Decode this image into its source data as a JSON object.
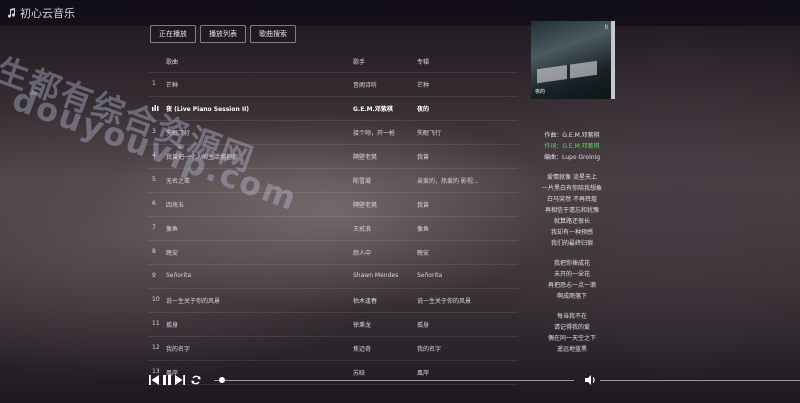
{
  "app": {
    "title": "初心云音乐"
  },
  "tabs": [
    {
      "label": "正在播放"
    },
    {
      "label": "播放列表"
    },
    {
      "label": "歌曲搜索"
    }
  ],
  "list": {
    "headers": {
      "title": "歌曲",
      "artist": "歌手",
      "album": "专辑"
    },
    "rows": [
      {
        "num": "1",
        "title": "芒种",
        "artist": "音阙诗听",
        "album": "芒种"
      },
      {
        "num": "",
        "title": "夜 (Live Piano Session II)",
        "artist": "G.E.M.邓紫棋",
        "album": "夜的"
      },
      {
        "num": "3",
        "title": "失眠飞行",
        "artist": "接个吻，开一枪",
        "album": "失眠飞行"
      },
      {
        "num": "4",
        "title": "我曾把一个人的生活拥抱你",
        "artist": "隔壁老樊",
        "album": "我曾"
      },
      {
        "num": "5",
        "title": "无名之辈",
        "artist": "陈雪凝",
        "album": "亲爱的，热爱的 影视..."
      },
      {
        "num": "6",
        "title": "四块五",
        "artist": "隔壁老樊",
        "album": "我曾"
      },
      {
        "num": "7",
        "title": "像鱼",
        "artist": "王贰浪",
        "album": "像鱼"
      },
      {
        "num": "8",
        "title": "晚安",
        "artist": "颜人中",
        "album": "晚安"
      },
      {
        "num": "9",
        "title": "Señorita",
        "artist": "Shawn Mendes",
        "album": "Señorita"
      },
      {
        "num": "10",
        "title": "说一生关于你的风景",
        "artist": "枯木逢春",
        "album": "说一生关于你的风景"
      },
      {
        "num": "11",
        "title": "孤身",
        "artist": "徐秉龙",
        "album": "孤身"
      },
      {
        "num": "12",
        "title": "我的名字",
        "artist": "焦迈奇",
        "album": "我的名字"
      },
      {
        "num": "13",
        "title": "風岸",
        "artist": "苏晗",
        "album": "風岸"
      }
    ]
  },
  "cover": {
    "tag": "II",
    "text": "夜的"
  },
  "lyrics": {
    "lines": [
      {
        "text": "作曲：G.E.M.邓紫棋",
        "hl": false
      },
      {
        "text": "作词：G.E.M.邓紫棋",
        "hl": true
      },
      {
        "text": "编曲：Lupo Groinig",
        "hl": false
      },
      {
        "text": "",
        "hl": false
      },
      {
        "text": "爱情就像 流星天上",
        "hl": false
      },
      {
        "text": "一片黑白有你陪我想象",
        "hl": false
      },
      {
        "text": "白马突然 不再辉煌",
        "hl": false
      },
      {
        "text": "再相信于遗忘和犹豫",
        "hl": false
      },
      {
        "text": "就算路还很长",
        "hl": false
      },
      {
        "text": "我却有一种预感",
        "hl": false
      },
      {
        "text": "我们的最终归宿",
        "hl": false
      },
      {
        "text": "",
        "hl": false
      },
      {
        "text": "我把你捧成花",
        "hl": false
      },
      {
        "text": "未开的一朵花",
        "hl": false
      },
      {
        "text": "再把恐忐一点一滴",
        "hl": false
      },
      {
        "text": "啊成雨落下",
        "hl": false
      },
      {
        "text": "",
        "hl": false
      },
      {
        "text": "每当我不在",
        "hl": false
      },
      {
        "text": "请记得我的爱",
        "hl": false
      },
      {
        "text": "偶在同一天空之下",
        "hl": false
      },
      {
        "text": "遥远地蓝黑",
        "hl": false
      }
    ]
  },
  "watermark": {
    "line1": "生都有综合资源网",
    "line2": "douyouvip.com"
  },
  "colors": {
    "lyric_highlight": "#5ed66b"
  },
  "icons": {
    "logo": "music-note-icon",
    "prev": "previous-icon",
    "pause": "pause-icon",
    "next": "next-icon",
    "loop": "loop-icon",
    "volume": "volume-icon",
    "playing": "playing-icon"
  }
}
